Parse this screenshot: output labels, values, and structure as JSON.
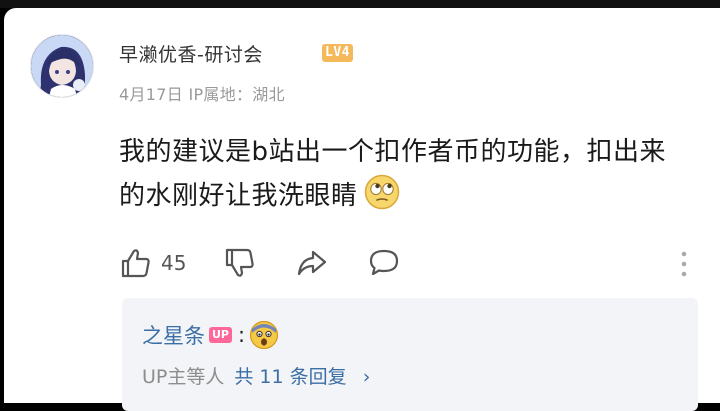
{
  "comment": {
    "user_name": "早濑优香-研讨会",
    "level_badge": "LV4",
    "date": "4月17日",
    "ip_location": "IP属地：湖北",
    "text": "我的建议是b站出一个扣作者币的功能，扣出来的水刚好让我洗眼睛",
    "emoji": "rolling-eyes-emoji",
    "like_count": "45"
  },
  "reply": {
    "user": "之星条",
    "badge": "UP",
    "colon": ":",
    "emoji": "shocked-face-emoji",
    "summary_prefix": "UP主等人",
    "summary_count": "共 11 条回复",
    "chevron": "›"
  },
  "colors": {
    "link_blue": "#3a6ea5",
    "level_badge": "#f5b85a",
    "up_badge": "#ff6699",
    "reply_bg": "#f3f4f7"
  }
}
